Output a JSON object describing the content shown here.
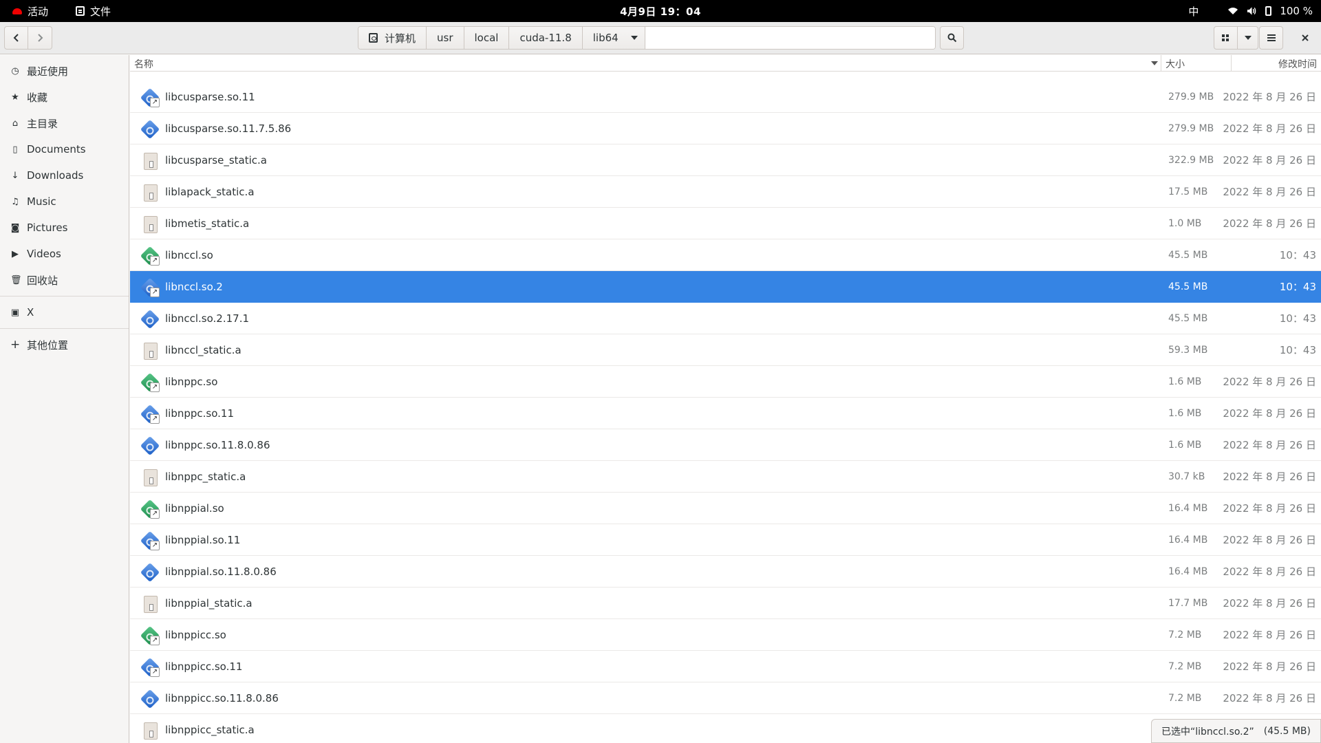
{
  "topbar": {
    "activities": "活动",
    "app_menu": "文件",
    "clock": "4月9日 19：04",
    "ime": "中",
    "battery": "100 %"
  },
  "header": {
    "breadcrumb": [
      "计算机",
      "usr",
      "local",
      "cuda-11.8",
      "lib64"
    ],
    "icons": {
      "back": "chevron-left-icon",
      "forward": "chevron-right-icon",
      "search": "search-icon",
      "view": "grid-view-icon",
      "menu": "hamburger-menu-icon",
      "close": "close-icon"
    }
  },
  "sidebar": {
    "items": [
      {
        "label": "最近使用",
        "icon": "clock-icon"
      },
      {
        "label": "收藏",
        "icon": "star-icon"
      },
      {
        "label": "主目录",
        "icon": "home-icon"
      },
      {
        "label": "Documents",
        "icon": "document-icon"
      },
      {
        "label": "Downloads",
        "icon": "download-icon"
      },
      {
        "label": "Music",
        "icon": "music-icon"
      },
      {
        "label": "Pictures",
        "icon": "camera-icon"
      },
      {
        "label": "Videos",
        "icon": "video-icon"
      },
      {
        "label": "回收站",
        "icon": "trash-icon"
      }
    ],
    "drives": [
      {
        "label": "X",
        "icon": "drive-icon"
      }
    ],
    "other": {
      "label": "其他位置",
      "icon": "plus-icon"
    }
  },
  "columns": {
    "name": "名称",
    "size": "大小",
    "modified": "修改时间"
  },
  "files": [
    {
      "name": "libcusparse.so.11",
      "size": "279.9 MB",
      "modified": "2022 年 8 月 26 日",
      "icon": "blue-link",
      "selected": false
    },
    {
      "name": "libcusparse.so.11.7.5.86",
      "size": "279.9 MB",
      "modified": "2022 年 8 月 26 日",
      "icon": "blue",
      "selected": false
    },
    {
      "name": "libcusparse_static.a",
      "size": "322.9 MB",
      "modified": "2022 年 8 月 26 日",
      "icon": "archive",
      "selected": false
    },
    {
      "name": "liblapack_static.a",
      "size": "17.5 MB",
      "modified": "2022 年 8 月 26 日",
      "icon": "archive",
      "selected": false
    },
    {
      "name": "libmetis_static.a",
      "size": "1.0 MB",
      "modified": "2022 年 8 月 26 日",
      "icon": "archive",
      "selected": false
    },
    {
      "name": "libnccl.so",
      "size": "45.5 MB",
      "modified": "10：43",
      "icon": "green-link",
      "selected": false
    },
    {
      "name": "libnccl.so.2",
      "size": "45.5 MB",
      "modified": "10：43",
      "icon": "blue-link",
      "selected": true
    },
    {
      "name": "libnccl.so.2.17.1",
      "size": "45.5 MB",
      "modified": "10：43",
      "icon": "blue",
      "selected": false
    },
    {
      "name": "libnccl_static.a",
      "size": "59.3 MB",
      "modified": "10：43",
      "icon": "archive",
      "selected": false
    },
    {
      "name": "libnppc.so",
      "size": "1.6 MB",
      "modified": "2022 年 8 月 26 日",
      "icon": "green-link",
      "selected": false
    },
    {
      "name": "libnppc.so.11",
      "size": "1.6 MB",
      "modified": "2022 年 8 月 26 日",
      "icon": "blue-link",
      "selected": false
    },
    {
      "name": "libnppc.so.11.8.0.86",
      "size": "1.6 MB",
      "modified": "2022 年 8 月 26 日",
      "icon": "blue",
      "selected": false
    },
    {
      "name": "libnppc_static.a",
      "size": "30.7 kB",
      "modified": "2022 年 8 月 26 日",
      "icon": "archive",
      "selected": false
    },
    {
      "name": "libnppial.so",
      "size": "16.4 MB",
      "modified": "2022 年 8 月 26 日",
      "icon": "green-link",
      "selected": false
    },
    {
      "name": "libnppial.so.11",
      "size": "16.4 MB",
      "modified": "2022 年 8 月 26 日",
      "icon": "blue-link",
      "selected": false
    },
    {
      "name": "libnppial.so.11.8.0.86",
      "size": "16.4 MB",
      "modified": "2022 年 8 月 26 日",
      "icon": "blue",
      "selected": false
    },
    {
      "name": "libnppial_static.a",
      "size": "17.7 MB",
      "modified": "2022 年 8 月 26 日",
      "icon": "archive",
      "selected": false
    },
    {
      "name": "libnppicc.so",
      "size": "7.2 MB",
      "modified": "2022 年 8 月 26 日",
      "icon": "green-link",
      "selected": false
    },
    {
      "name": "libnppicc.so.11",
      "size": "7.2 MB",
      "modified": "2022 年 8 月 26 日",
      "icon": "blue-link",
      "selected": false
    },
    {
      "name": "libnppicc.so.11.8.0.86",
      "size": "7.2 MB",
      "modified": "2022 年 8 月 26 日",
      "icon": "blue",
      "selected": false
    },
    {
      "name": "libnppicc_static.a",
      "size": "",
      "modified": "",
      "icon": "archive",
      "selected": false
    }
  ],
  "status": {
    "selected_text": "已选中“libnccl.so.2”",
    "selected_size": "(45.5 MB)"
  },
  "colors": {
    "selection": "#3584e4",
    "topbar": "#000000"
  }
}
